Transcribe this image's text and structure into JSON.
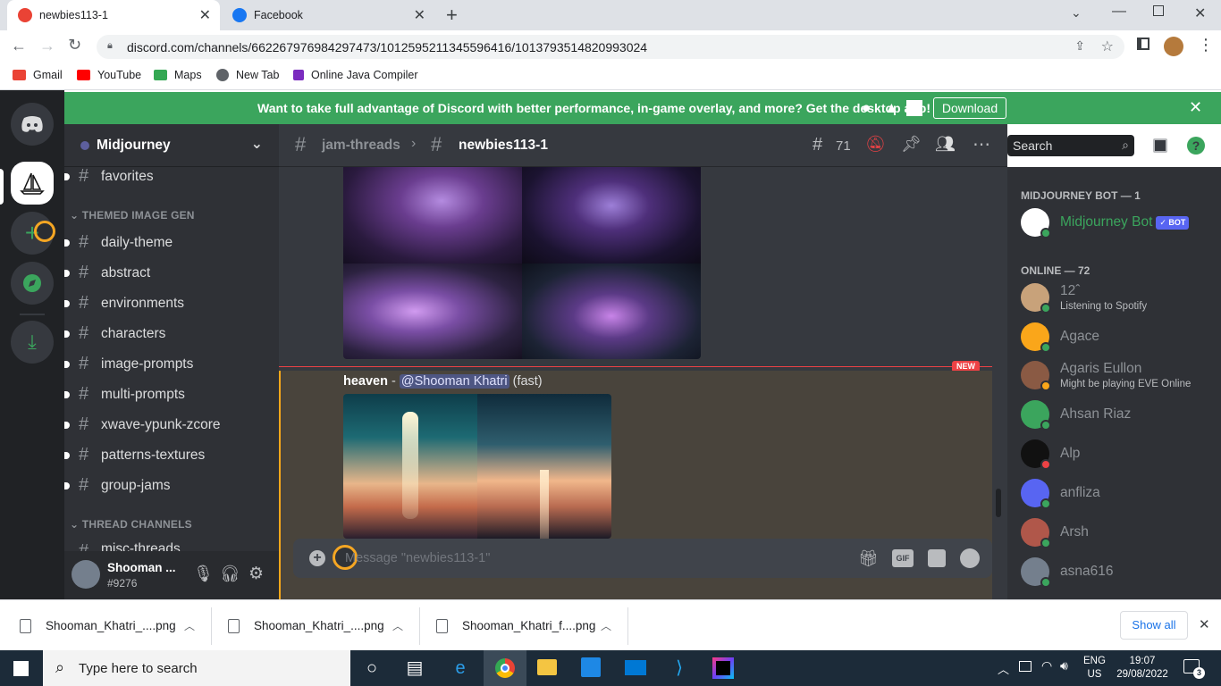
{
  "browser": {
    "tabs": [
      {
        "title": "newbies113-1"
      },
      {
        "title": "Facebook"
      }
    ],
    "url": "discord.com/channels/662267976984297473/1012595211345596416/1013793514820993024",
    "bookmarks": [
      {
        "label": "Gmail",
        "color": "#ea4335"
      },
      {
        "label": "YouTube",
        "color": "#ff0000"
      },
      {
        "label": "Maps",
        "color": "#34a853"
      },
      {
        "label": "New Tab",
        "color": "#5f6368"
      },
      {
        "label": "Online Java Compiler",
        "color": "#7b2cbf"
      }
    ]
  },
  "banner": {
    "text": "Want to take full advantage of Discord with better performance, in-game overlay, and more? Get the desktop app!",
    "download": "Download"
  },
  "server": {
    "name": "Midjourney"
  },
  "channels": {
    "favorites": "favorites",
    "cat1": "THEMED IMAGE GEN",
    "list": [
      "daily-theme",
      "abstract",
      "environments",
      "characters",
      "image-prompts",
      "multi-prompts",
      "xwave-ypunk-zcore",
      "patterns-textures",
      "group-jams"
    ],
    "cat2": "THREAD CHANNELS",
    "misc": "misc-threads"
  },
  "user": {
    "name": "Shooman ...",
    "tag": "#9276"
  },
  "header": {
    "parent": "jam-threads",
    "thread": "newbies113-1",
    "threads_count": "71",
    "search_placeholder": "Search"
  },
  "message": {
    "prompt": "heaven",
    "dash": " - ",
    "mention": "@Shooman Khatri",
    "mode": "(fast)",
    "new_label": "NEW"
  },
  "composer": {
    "placeholder": "Message \"newbies113-1\"",
    "gif": "GIF"
  },
  "members": {
    "bot_header": "MIDJOURNEY BOT — 1",
    "bot": {
      "name": "Midjourney Bot",
      "badge": "✓ BOT"
    },
    "online_header": "ONLINE — 72",
    "list": [
      {
        "name": "12ˆ",
        "sub": "Listening to Spotify",
        "color": "#c8a27a"
      },
      {
        "name": "Agace",
        "sub": "",
        "color": "#faa61a"
      },
      {
        "name": "Agaris Eullon",
        "sub": "Might be playing EVE Online",
        "color": "#8a5a44"
      },
      {
        "name": "Ahsan Riaz",
        "sub": "",
        "color": "#3ba55d"
      },
      {
        "name": "Alp",
        "sub": "",
        "color": "#111111"
      },
      {
        "name": "anfliza",
        "sub": "",
        "color": "#5865f2"
      },
      {
        "name": "Arsh",
        "sub": "",
        "color": "#b0574a"
      },
      {
        "name": "asna616",
        "sub": "",
        "color": "#747f8d"
      }
    ]
  },
  "downloads": {
    "files": [
      "Shooman_Khatri_....png",
      "Shooman_Khatri_....png",
      "Shooman_Khatri_f....png"
    ],
    "show_all": "Show all"
  },
  "taskbar": {
    "search": "Type here to search",
    "lang": "ENG",
    "region": "US",
    "time": "19:07",
    "date": "29/08/2022",
    "notif": "3"
  }
}
